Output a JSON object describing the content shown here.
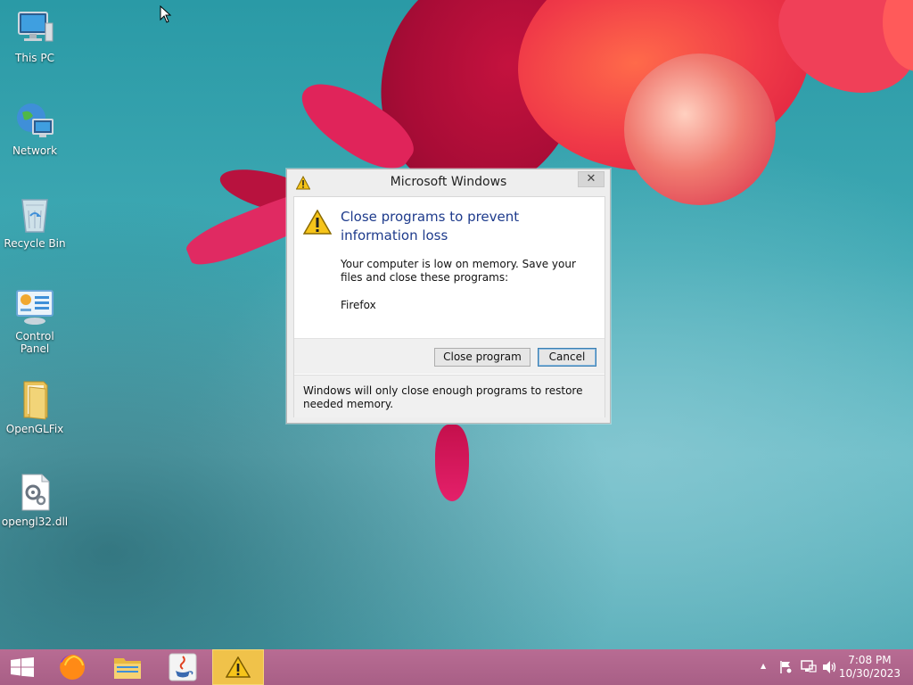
{
  "desktop": {
    "icons": [
      {
        "label": "This PC",
        "icon": "computer-icon"
      },
      {
        "label": "Network",
        "icon": "network-icon"
      },
      {
        "label": "Recycle Bin",
        "icon": "recycle-bin-icon"
      },
      {
        "label": "Control Panel",
        "icon": "control-panel-icon"
      },
      {
        "label": "OpenGLFix",
        "icon": "folder-icon"
      },
      {
        "label": "opengl32.dll",
        "icon": "dll-file-icon"
      }
    ]
  },
  "dialog": {
    "title": "Microsoft Windows",
    "close_glyph": "✕",
    "instruction": "Close programs to prevent information loss",
    "message": "Your computer is low on memory. Save your files and close these programs:",
    "program": "Firefox",
    "buttons": {
      "close_program": "Close program",
      "cancel": "Cancel"
    },
    "footer": "Windows will only close enough programs to restore needed memory."
  },
  "taskbar": {
    "items": [
      {
        "name": "start",
        "icon": "windows-logo-icon"
      },
      {
        "name": "firefox",
        "icon": "firefox-icon"
      },
      {
        "name": "file-explorer",
        "icon": "folder-icon"
      },
      {
        "name": "java",
        "icon": "java-icon"
      },
      {
        "name": "warning-dialog",
        "icon": "warning-icon",
        "active": true
      }
    ],
    "tray": {
      "icons": [
        "chevron-up-icon",
        "flag-icon",
        "network-icon",
        "speaker-icon"
      ],
      "chevron_glyph": "▲",
      "time": "7:08 PM",
      "date": "10/30/2023"
    }
  },
  "colors": {
    "desktop_teal": "#3fa9b4",
    "taskbar": "#b06890",
    "instruction_blue": "#1e3b8c",
    "active_task": "#f0c24a"
  }
}
